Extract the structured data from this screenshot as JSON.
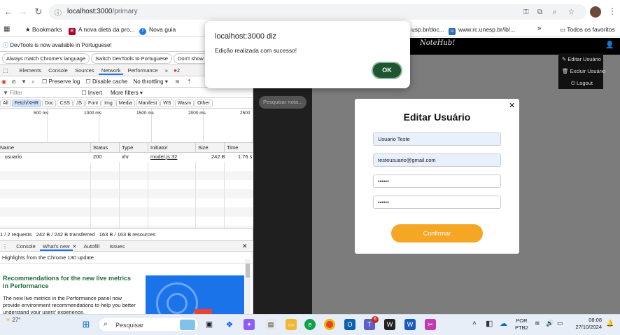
{
  "browser": {
    "url_host": "localhost:3000",
    "url_path": "/primary",
    "bookmarks": [
      {
        "label": "Bookmarks",
        "color": "#202124"
      },
      {
        "label": "A nova dieta da pro...",
        "color": "#b00020"
      },
      {
        "label": "Nova guia",
        "color": "#1877f2"
      },
      {
        "label": "usp.br/doc...",
        "color": "#5f6368"
      },
      {
        "label": "www.rc.unesp.br/ib/...",
        "color": "#5f6368"
      }
    ],
    "all_bookmarks": "Todos os favoritos",
    "chevron": "»"
  },
  "devtools": {
    "lang_notice": "DevTools is now available in Portuguese!",
    "lang_buttons": [
      "Always match Chrome's language",
      "Switch DevTools to Portuguese",
      "Don't show a"
    ],
    "tabs": [
      "Elements",
      "Console",
      "Sources",
      "Network",
      "Performance",
      "»"
    ],
    "error_count": "2",
    "preserve_log": "Preserve log",
    "disable_cache": "Disable cache",
    "throttling": "No throttling",
    "filter_placeholder": "Filter",
    "invert": "Invert",
    "more_filters": "More filters",
    "filter_types": [
      "All",
      "Fetch/XHR",
      "Doc",
      "CSS",
      "JS",
      "Font",
      "Img",
      "Media",
      "Manifest",
      "WS",
      "Wasm",
      "Other"
    ],
    "timeline_ticks": [
      "500 ms",
      "1000 ms",
      "1500 ms",
      "2000 ms",
      "2500"
    ],
    "columns": [
      "Name",
      "Status",
      "Type",
      "Initiator",
      "Size",
      "Time"
    ],
    "rows": [
      {
        "name": "usuario",
        "status": "200",
        "type": "xhr",
        "initiator": "model.js:32",
        "size": "242 B",
        "time": "1.76 s"
      }
    ],
    "summary": "1 / 2 requests   242 B / 242 B transferred   163 B / 163 B resources",
    "drawer_tabs": [
      "Console",
      "What's new",
      "Autofill",
      "Issues"
    ],
    "highlights": "Highlights from the Chrome 130 update",
    "article_title": "Recommendations for the new live metrics in Performance",
    "article_body": "The new live metrics in the Performance panel now provide environment recommendations to help you better understand your users' experience."
  },
  "app": {
    "logo": "NoteHub!",
    "search_placeholder": "Pesquisar nota...",
    "menu": [
      "Editar Usuário",
      "Excluir Usuário",
      "Logout"
    ],
    "modal": {
      "title": "Editar Usuário",
      "name_value": "Usuario Teste",
      "email_value": "testeusuario@gmail.com",
      "password_mask": "••••••",
      "confirm_mask": "••••••",
      "confirm_label": "Confirmar",
      "close_glyph": "✕"
    }
  },
  "alert": {
    "title": "localhost:3000 diz",
    "message": "Edição realizada com sucesso!",
    "ok_label": "OK"
  },
  "taskbar": {
    "temp": "27°",
    "search_label": "Pesquisar",
    "lang_line1": "POR",
    "lang_line2": "PTB2",
    "time": "08:08",
    "date": "27/10/2024",
    "teams_badge": "6"
  }
}
